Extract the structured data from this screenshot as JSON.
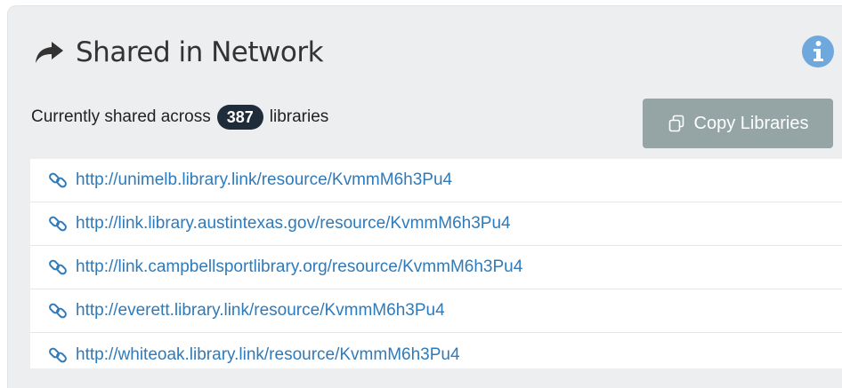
{
  "header": {
    "title": "Shared in Network",
    "title_icon": "share-arrow-icon",
    "info_icon": "info-circle-icon"
  },
  "shared": {
    "prefix": "Currently shared across",
    "count": "387",
    "suffix": "libraries"
  },
  "copy_button": {
    "label": "Copy Libraries",
    "icon": "copy-icon"
  },
  "links": [
    "http://unimelb.library.link/resource/KvmmM6h3Pu4",
    "http://link.library.austintexas.gov/resource/KvmmM6h3Pu4",
    "http://link.campbellsportlibrary.org/resource/KvmmM6h3Pu4",
    "http://everett.library.link/resource/KvmmM6h3Pu4",
    "http://whiteoak.library.link/resource/KvmmM6h3Pu4"
  ],
  "colors": {
    "panel_background": "#eceeef",
    "link": "#2f7ab9",
    "badge_background": "#1f2d3a",
    "button_background": "#95a5a6",
    "info_icon": "#6fa8dc"
  }
}
